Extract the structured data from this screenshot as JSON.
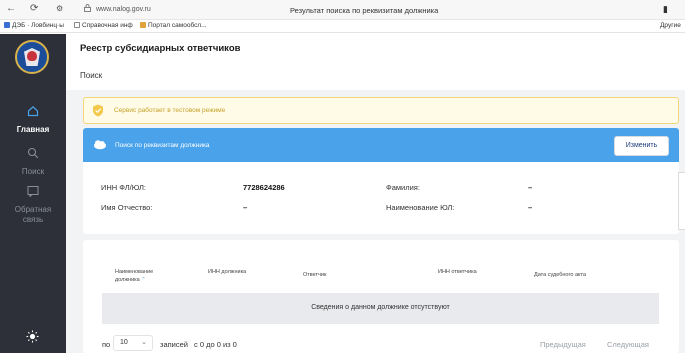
{
  "browser": {
    "url": "www.nalog.gov.ru",
    "tab_title": "Результат поиска по реквизитам должника",
    "bookmarks": [
      {
        "label": "ДЭБ · Ловбинц·ы",
        "color": "#3c6fd3"
      },
      {
        "label": "Справочная инф",
        "color": "#888888"
      },
      {
        "label": "Портал самообсл...",
        "color": "#e2a23a"
      }
    ],
    "bookmarks_other": "Другие"
  },
  "sidebar": {
    "items": [
      {
        "label": "Главная",
        "icon": "home-icon"
      },
      {
        "label": "Поиск",
        "icon": "search-icon"
      },
      {
        "label": "Обратная связь",
        "icon": "feedback-icon"
      }
    ],
    "theme_icon": "sun-icon"
  },
  "header": {
    "title": "Реестр субсидиарных ответчиков",
    "subtitle": "Поиск"
  },
  "alert": {
    "text": "Сервис работает в тестовом режиме",
    "color": "#c7a12b"
  },
  "search": {
    "heading": "Поиск по реквизитам должника",
    "change_button": "Изменить",
    "fields": {
      "inn_label": "ИНН ФЛ/ЮЛ:",
      "inn_value": "7728624286",
      "surname_label": "Фамилия:",
      "surname_value": "–",
      "name_label": "Имя Отчество:",
      "name_value": "–",
      "org_label": "Наименование ЮЛ:",
      "org_value": "–"
    }
  },
  "results": {
    "columns": [
      "Наименование должника",
      "ИНН должника",
      "Ответчик",
      "ИНН ответчика",
      "Дата судебного акта"
    ],
    "empty_text": "Сведения о данном должнике отсутствуют"
  },
  "pagination": {
    "prefix": "по",
    "per_page": "10",
    "suffix": "записей",
    "range": "с 0 до 0 из 0",
    "prev": "Предыдущая",
    "next": "Следующая"
  },
  "colors": {
    "sidebar_bg": "#2d3039",
    "accent_blue": "#4aa3ea",
    "alert_bg": "#fffbe6"
  }
}
